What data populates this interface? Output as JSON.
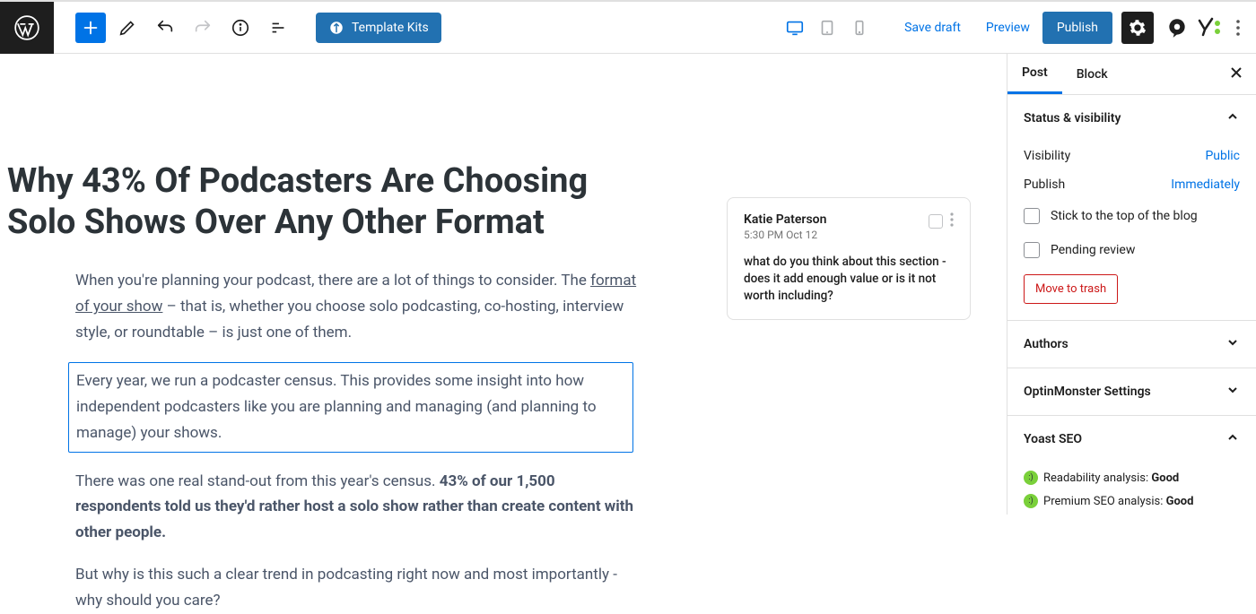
{
  "toolbar": {
    "template_kits": "Template Kits",
    "save_draft": "Save draft",
    "preview": "Preview",
    "publish": "Publish"
  },
  "post": {
    "title": "Why 43% Of Podcasters Are Choosing Solo Shows Over Any Other Format",
    "p1_a": "When you're planning your podcast, there are a lot of things to consider. The ",
    "p1_link": "format of your show",
    "p1_b": " – that is, whether you choose solo podcasting, co-hosting, interview style, or roundtable – is just one of them.",
    "p2": "Every year, we run a podcaster census. This provides some insight into how independent podcasters like you are planning and managing (and planning to manage) your shows.",
    "p3_a": "There was one real stand-out from this year's census. ",
    "p3_bold": "43% of our 1,500 respondents told us they'd rather host a solo show rather than create content with other people.",
    "p4": "But why is this such a clear trend in podcasting right now and most importantly - why should you care?"
  },
  "comment": {
    "author": "Katie Paterson",
    "time": "5:30 PM Oct 12",
    "body": "what do you think about this section - does it add enough value or is it not worth including?"
  },
  "sidebar": {
    "tabs": {
      "post": "Post",
      "block": "Block"
    },
    "status_visibility": "Status & visibility",
    "visibility_label": "Visibility",
    "visibility_value": "Public",
    "publish_label": "Publish",
    "publish_value": "Immediately",
    "stick": "Stick to the top of the blog",
    "pending": "Pending review",
    "trash": "Move to trash",
    "authors": "Authors",
    "optinmonster": "OptinMonster Settings",
    "yoast": "Yoast SEO",
    "readability_a": "Readability analysis: ",
    "readability_b": "Good",
    "premium_a": "Premium SEO analysis: ",
    "premium_b": "Good"
  }
}
